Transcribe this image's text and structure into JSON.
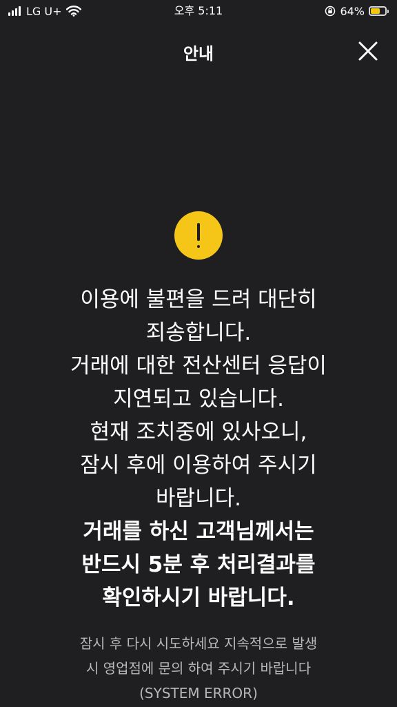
{
  "status_bar": {
    "carrier": "LG U+",
    "time": "오후 5:11",
    "battery_percent": "64%",
    "battery_level": 0.64,
    "icons": [
      "signal-icon",
      "wifi-icon",
      "orientation-lock-icon",
      "battery-icon"
    ],
    "battery_color": "#f2c811"
  },
  "header": {
    "title": "안내",
    "close_icon": "close-icon"
  },
  "alert": {
    "icon": "exclamation-icon",
    "icon_color": "#f5c518",
    "lines": [
      "이용에 불편을 드려 대단히",
      "죄송합니다.",
      "거래에 대한 전산센터 응답이",
      "지연되고 있습니다.",
      "현재 조치중에 있사오니,",
      "잠시 후에 이용하여 주시기",
      "바랍니다."
    ],
    "bold_lines": [
      "거래를 하신 고객님께서는",
      "반드시 5분 후 처리결과를",
      "확인하시기 바랍니다."
    ],
    "sub_lines": [
      "잠시 후 다시 시도하세요 지속적으로 발생",
      "시 영업점에 문의 하여 주시기 바랍니다",
      "(SYSTEM ERROR)"
    ]
  },
  "colors": {
    "background": "#1f1f22",
    "text": "#ffffff",
    "sub_text": "#b8b8b8"
  }
}
